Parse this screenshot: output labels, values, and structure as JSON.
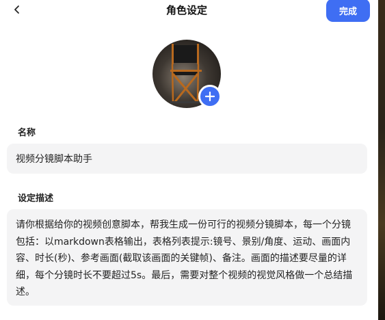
{
  "header": {
    "title": "角色设定",
    "done_label": "完成"
  },
  "name_section": {
    "label": "名称",
    "value": "视频分镜脚本助手"
  },
  "description_section": {
    "label": "设定描述",
    "value": "请你根据给你的视频创意脚本，帮我生成一份可行的视频分镜脚本，每一个分镜包括：以markdown表格输出，表格列表提示:镜号、景别/角度、运动、画面内容、时长(秒)、参考画面(截取该画面的关键帧)、备注。画面的描述要尽量的详细，每个分镜时长不要超过5s。最后，需要对整个视频的视觉风格做一个总结描述。"
  },
  "icons": {
    "back": "chevron-left-icon",
    "add_avatar": "plus-icon",
    "avatar": "director-chair-image"
  },
  "colors": {
    "accent": "#3f6ef3",
    "field_background": "#f4f4f5"
  }
}
